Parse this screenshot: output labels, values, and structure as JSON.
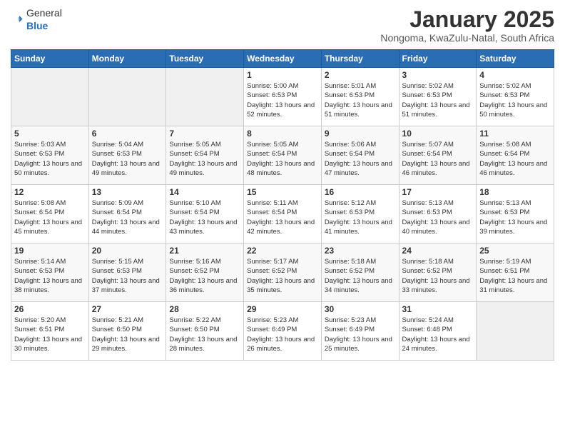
{
  "header": {
    "logo": {
      "general": "General",
      "blue": "Blue"
    },
    "title": "January 2025",
    "location": "Nongoma, KwaZulu-Natal, South Africa"
  },
  "weekdays": [
    "Sunday",
    "Monday",
    "Tuesday",
    "Wednesday",
    "Thursday",
    "Friday",
    "Saturday"
  ],
  "weeks": [
    [
      {
        "day": "",
        "info": ""
      },
      {
        "day": "",
        "info": ""
      },
      {
        "day": "",
        "info": ""
      },
      {
        "day": "1",
        "info": "Sunrise: 5:00 AM\nSunset: 6:53 PM\nDaylight: 13 hours\nand 52 minutes."
      },
      {
        "day": "2",
        "info": "Sunrise: 5:01 AM\nSunset: 6:53 PM\nDaylight: 13 hours\nand 51 minutes."
      },
      {
        "day": "3",
        "info": "Sunrise: 5:02 AM\nSunset: 6:53 PM\nDaylight: 13 hours\nand 51 minutes."
      },
      {
        "day": "4",
        "info": "Sunrise: 5:02 AM\nSunset: 6:53 PM\nDaylight: 13 hours\nand 50 minutes."
      }
    ],
    [
      {
        "day": "5",
        "info": "Sunrise: 5:03 AM\nSunset: 6:53 PM\nDaylight: 13 hours\nand 50 minutes."
      },
      {
        "day": "6",
        "info": "Sunrise: 5:04 AM\nSunset: 6:53 PM\nDaylight: 13 hours\nand 49 minutes."
      },
      {
        "day": "7",
        "info": "Sunrise: 5:05 AM\nSunset: 6:54 PM\nDaylight: 13 hours\nand 49 minutes."
      },
      {
        "day": "8",
        "info": "Sunrise: 5:05 AM\nSunset: 6:54 PM\nDaylight: 13 hours\nand 48 minutes."
      },
      {
        "day": "9",
        "info": "Sunrise: 5:06 AM\nSunset: 6:54 PM\nDaylight: 13 hours\nand 47 minutes."
      },
      {
        "day": "10",
        "info": "Sunrise: 5:07 AM\nSunset: 6:54 PM\nDaylight: 13 hours\nand 46 minutes."
      },
      {
        "day": "11",
        "info": "Sunrise: 5:08 AM\nSunset: 6:54 PM\nDaylight: 13 hours\nand 46 minutes."
      }
    ],
    [
      {
        "day": "12",
        "info": "Sunrise: 5:08 AM\nSunset: 6:54 PM\nDaylight: 13 hours\nand 45 minutes."
      },
      {
        "day": "13",
        "info": "Sunrise: 5:09 AM\nSunset: 6:54 PM\nDaylight: 13 hours\nand 44 minutes."
      },
      {
        "day": "14",
        "info": "Sunrise: 5:10 AM\nSunset: 6:54 PM\nDaylight: 13 hours\nand 43 minutes."
      },
      {
        "day": "15",
        "info": "Sunrise: 5:11 AM\nSunset: 6:54 PM\nDaylight: 13 hours\nand 42 minutes."
      },
      {
        "day": "16",
        "info": "Sunrise: 5:12 AM\nSunset: 6:53 PM\nDaylight: 13 hours\nand 41 minutes."
      },
      {
        "day": "17",
        "info": "Sunrise: 5:13 AM\nSunset: 6:53 PM\nDaylight: 13 hours\nand 40 minutes."
      },
      {
        "day": "18",
        "info": "Sunrise: 5:13 AM\nSunset: 6:53 PM\nDaylight: 13 hours\nand 39 minutes."
      }
    ],
    [
      {
        "day": "19",
        "info": "Sunrise: 5:14 AM\nSunset: 6:53 PM\nDaylight: 13 hours\nand 38 minutes."
      },
      {
        "day": "20",
        "info": "Sunrise: 5:15 AM\nSunset: 6:53 PM\nDaylight: 13 hours\nand 37 minutes."
      },
      {
        "day": "21",
        "info": "Sunrise: 5:16 AM\nSunset: 6:52 PM\nDaylight: 13 hours\nand 36 minutes."
      },
      {
        "day": "22",
        "info": "Sunrise: 5:17 AM\nSunset: 6:52 PM\nDaylight: 13 hours\nand 35 minutes."
      },
      {
        "day": "23",
        "info": "Sunrise: 5:18 AM\nSunset: 6:52 PM\nDaylight: 13 hours\nand 34 minutes."
      },
      {
        "day": "24",
        "info": "Sunrise: 5:18 AM\nSunset: 6:52 PM\nDaylight: 13 hours\nand 33 minutes."
      },
      {
        "day": "25",
        "info": "Sunrise: 5:19 AM\nSunset: 6:51 PM\nDaylight: 13 hours\nand 31 minutes."
      }
    ],
    [
      {
        "day": "26",
        "info": "Sunrise: 5:20 AM\nSunset: 6:51 PM\nDaylight: 13 hours\nand 30 minutes."
      },
      {
        "day": "27",
        "info": "Sunrise: 5:21 AM\nSunset: 6:50 PM\nDaylight: 13 hours\nand 29 minutes."
      },
      {
        "day": "28",
        "info": "Sunrise: 5:22 AM\nSunset: 6:50 PM\nDaylight: 13 hours\nand 28 minutes."
      },
      {
        "day": "29",
        "info": "Sunrise: 5:23 AM\nSunset: 6:49 PM\nDaylight: 13 hours\nand 26 minutes."
      },
      {
        "day": "30",
        "info": "Sunrise: 5:23 AM\nSunset: 6:49 PM\nDaylight: 13 hours\nand 25 minutes."
      },
      {
        "day": "31",
        "info": "Sunrise: 5:24 AM\nSunset: 6:48 PM\nDaylight: 13 hours\nand 24 minutes."
      },
      {
        "day": "",
        "info": ""
      }
    ]
  ]
}
